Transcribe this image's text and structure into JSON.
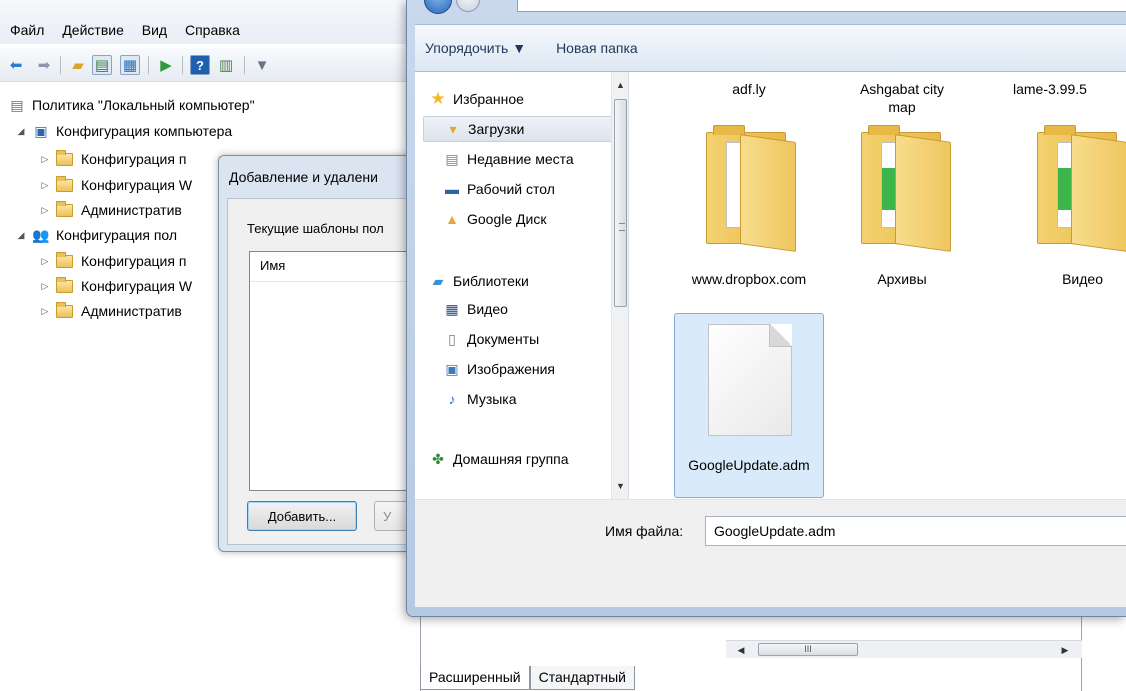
{
  "mmc": {
    "menu": [
      "Файл",
      "Действие",
      "Вид",
      "Справка"
    ],
    "toolbar_icons": [
      "back-arrow-icon",
      "forward-arrow-icon",
      "up-folder-icon",
      "show-hide-tree-icon",
      "export-list-icon",
      "help-icon",
      "action-pane-icon",
      "filter-icon"
    ],
    "tree": {
      "root": "Политика \"Локальный компьютер\"",
      "computer_config": "Конфигурация компьютера",
      "computer_children": [
        "Конфигурация п",
        "Конфигурация W",
        "Административ"
      ],
      "user_config": "Конфигурация пол",
      "user_children": [
        "Конфигурация п",
        "Конфигурация W",
        "Административ"
      ]
    },
    "tabs": [
      "Расширенный",
      "Стандартный"
    ],
    "scroll_thumb_glyph": "III"
  },
  "addremove": {
    "title": "Добавление и удалени",
    "label": "Текущие шаблоны пол",
    "column": "Имя",
    "add_button": "Добавить...",
    "remove_button": "У"
  },
  "opendlg": {
    "organize": "Упорядочить ▼",
    "new_folder": "Новая папка",
    "nav": {
      "favorites": "Избранное",
      "downloads": "Загрузки",
      "recent": "Недавние места",
      "desktop": "Рабочий стол",
      "gdrive": "Google Диск",
      "libraries": "Библиотеки",
      "video": "Видео",
      "documents": "Документы",
      "images": "Изображения",
      "music": "Музыка",
      "homegroup": "Домашняя группа"
    },
    "files": {
      "adfly": "adf.ly",
      "ashgabat": "Ashgabat city map",
      "lame": "lame-3.99.5",
      "dropbox": "www.dropbox.com",
      "archives": "Архивы",
      "video": "Видео",
      "googleupdate": "GoogleUpdate.adm"
    },
    "filename_label": "Имя файла:",
    "filename_value": "GoogleUpdate.adm"
  },
  "colors": {
    "selection": "#d9ebfb",
    "selection_border": "#84acdd",
    "command_text": "#1e395b"
  }
}
